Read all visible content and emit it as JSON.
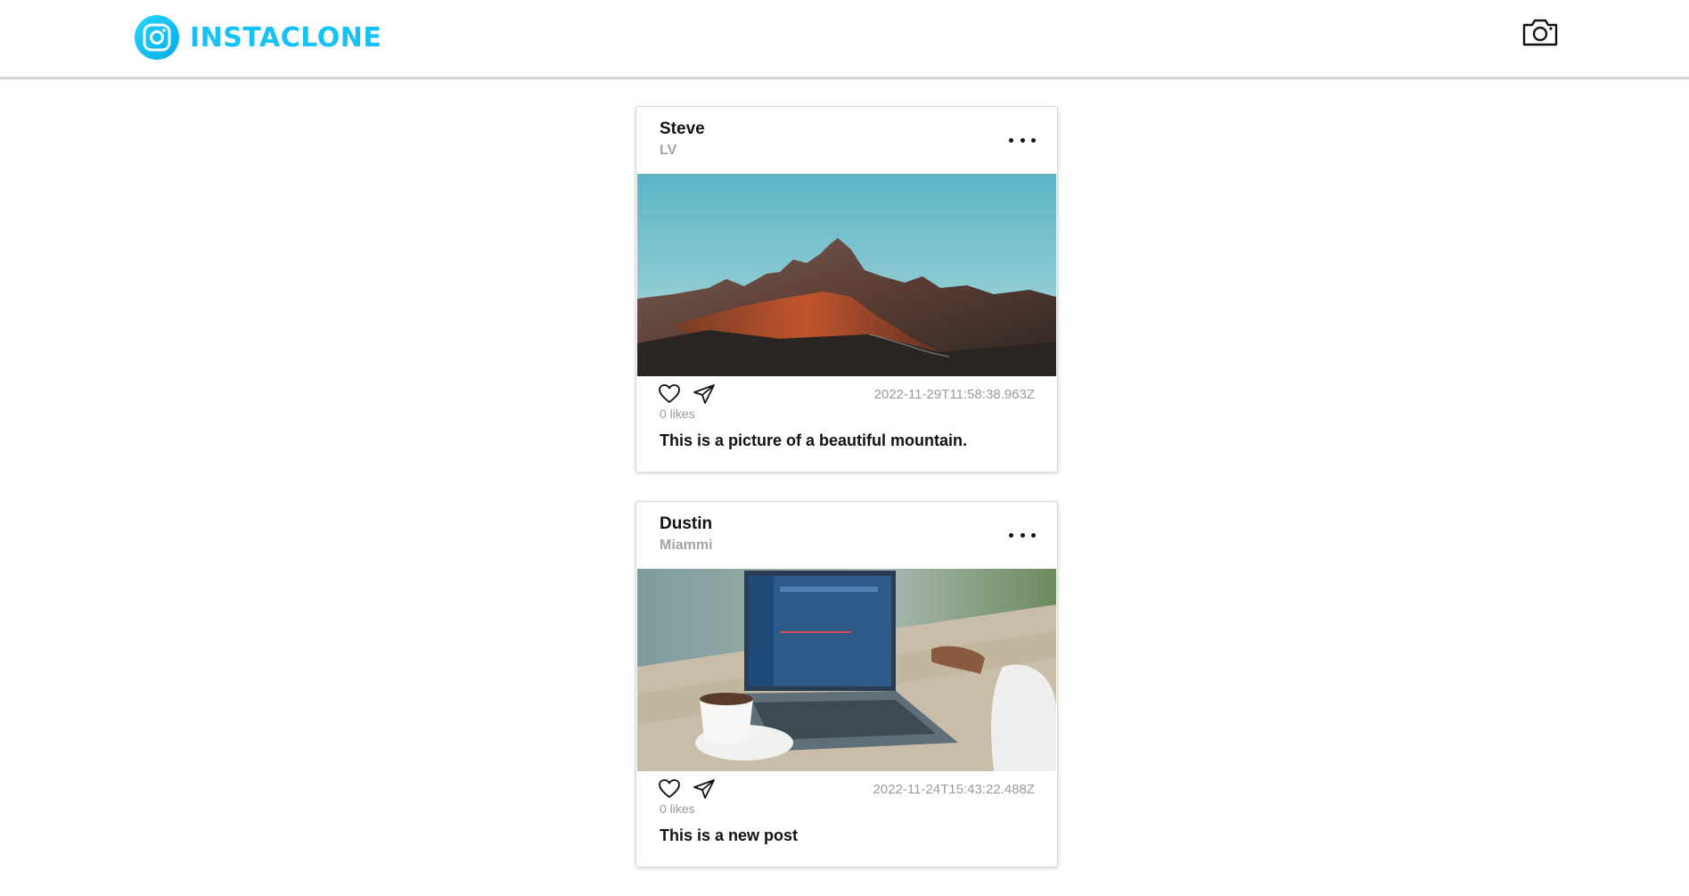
{
  "header": {
    "logo_text": "INSTACLONE",
    "logo_icon": "instagram-logo-icon",
    "camera_icon": "camera-icon",
    "brand_color": "#14c2f4"
  },
  "posts": [
    {
      "user": "Steve",
      "location": "LV",
      "image": "mountain-photo",
      "timestamp": "2022-11-29T11:58:38.963Z",
      "likes": "0 likes",
      "caption": "This is a picture of a beautiful mountain."
    },
    {
      "user": "Dustin",
      "location": "Miammi",
      "image": "laptop-coffee-photo",
      "timestamp": "2022-11-24T15:43:22.488Z",
      "likes": "0 likes",
      "caption": "This is a new post"
    }
  ]
}
